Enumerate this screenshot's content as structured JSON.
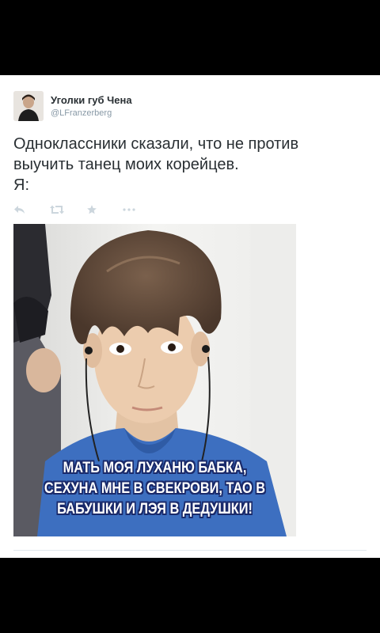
{
  "author": {
    "display_name": "Уголки губ Чена",
    "handle": "@LFranzerberg"
  },
  "tweet": {
    "lines": [
      "Одноклассники сказали, что не против",
      "выучить танец моих корейцев.",
      "Я:"
    ]
  },
  "actions": {
    "reply_icon": "reply-icon",
    "retweet_icon": "retweet-icon",
    "favorite_icon": "star-icon",
    "more_icon": "more-icon"
  },
  "media": {
    "caption_lines": [
      "МАТЬ МОЯ ЛУХАНЮ БАБКА,",
      "СЕХУНА МНЕ В СВЕКРОВИ, ТАО В",
      "БАБУШКИ И ЛЭЯ В ДЕДУШКИ!"
    ]
  },
  "colors": {
    "background": "#000000",
    "card": "#ffffff",
    "text": "#292f33",
    "muted": "#8899a6",
    "shirt": "#3d6fc0",
    "hair": "#5a4536"
  }
}
